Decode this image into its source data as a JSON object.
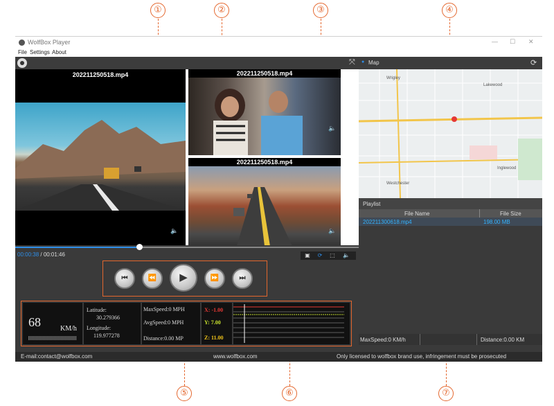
{
  "callouts": [
    "①",
    "②",
    "③",
    "④",
    "⑤",
    "⑥",
    "⑦"
  ],
  "window": {
    "title": "WolfBox Player",
    "menu": [
      "File",
      "Settings",
      "About"
    ],
    "controls": {
      "minimize": "—",
      "maximize": "☐",
      "close": "✕"
    }
  },
  "videos": [
    {
      "filename": "202211250518.mp4"
    },
    {
      "filename": "202211250518.mp4"
    },
    {
      "filename": "202211250518.mp4"
    }
  ],
  "playback": {
    "current_time": "00:00:38",
    "separator": " / ",
    "total_time": "00:01:46",
    "progress_fraction": 0.36,
    "buttons": [
      "skip-previous-icon",
      "rewind-icon",
      "play-icon",
      "fast-forward-icon",
      "skip-next-icon"
    ]
  },
  "speed": {
    "value": "68",
    "unit": "KM/h"
  },
  "gps": {
    "latitude_label": "Latitude:",
    "latitude": "30.279366",
    "longitude_label": "Longitude:",
    "longitude": "119.977278"
  },
  "stats": {
    "max_speed": "MaxSpeed:0 MPH",
    "avg_speed": "AvgSpeed:0 MPH",
    "distance": "Distance:0.00 MP"
  },
  "gsensor": {
    "x": "X: -1.00",
    "y": "Y: 7.00",
    "z": "Z: 11.00"
  },
  "map": {
    "title": "Map",
    "labels": [
      "Wrigley",
      "Westchester",
      "Lakewood",
      "Inglewood"
    ]
  },
  "playlist": {
    "title": "Playlist",
    "col_name": "File Name",
    "col_size": "File Size",
    "rows": [
      {
        "name": "202211300618.mp4",
        "size": "198.00 MB"
      }
    ],
    "footer_max": "MaxSpeed:0 KM/h",
    "footer_dist": "Distance:0.00 KM"
  },
  "status": {
    "email": "E-mail:contact@wolfbox.com",
    "website": "www.wolfbox.com",
    "license": "Only licensed to wolfbox brand use, infringement must be prosecuted"
  },
  "colors": {
    "accent": "#e4672e",
    "link": "#2e8ee8",
    "gsensor_x": "#e53935",
    "gsensor_y": "#c6e02e",
    "gsensor_z": "#f0c419"
  }
}
